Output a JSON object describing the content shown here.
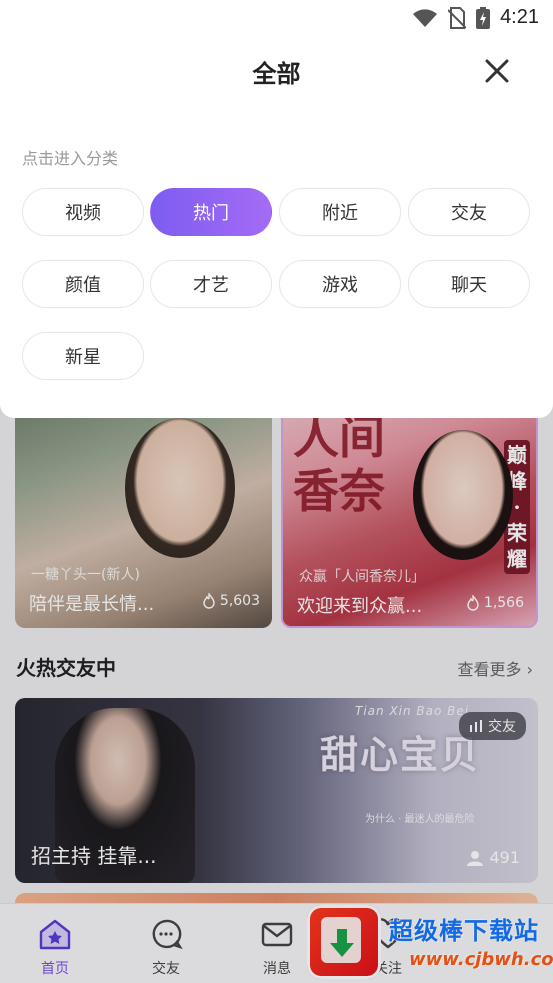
{
  "status_bar": {
    "time": "4:21"
  },
  "sheet": {
    "title": "全部",
    "hint": "点击进入分类",
    "categories": [
      {
        "label": "视频",
        "selected": false
      },
      {
        "label": "热门",
        "selected": true
      },
      {
        "label": "附近",
        "selected": false
      },
      {
        "label": "交友",
        "selected": false
      },
      {
        "label": "颜值",
        "selected": false
      },
      {
        "label": "才艺",
        "selected": false
      },
      {
        "label": "游戏",
        "selected": false
      },
      {
        "label": "聊天",
        "selected": false
      },
      {
        "label": "新星",
        "selected": false
      }
    ]
  },
  "feed": {
    "cards": [
      {
        "subtitle": "一糖丫头一(新人)",
        "title": "陪伴是最长情...",
        "count": "5,603"
      },
      {
        "subtitle": "众赢「人间香奈儿」",
        "title": "欢迎来到众赢...",
        "count": "1,566",
        "poster_text": "人间香奈",
        "side_text": "巅峰·荣耀"
      }
    ],
    "section": {
      "title": "火热交友中",
      "more": "查看更多"
    },
    "live": {
      "tag": "交友",
      "title": "招主持 挂靠...",
      "viewers": "491",
      "poster_title": "甜心宝贝",
      "poster_script": "Tian Xin Bao Bei",
      "poster_caption": "为什么 · 最迷人的最危险"
    }
  },
  "bottom_nav": [
    {
      "label": "首页",
      "icon": "home-icon",
      "active": true
    },
    {
      "label": "交友",
      "icon": "chat-bubble-icon",
      "active": false
    },
    {
      "label": "消息",
      "icon": "mail-icon",
      "active": false
    },
    {
      "label": "关注",
      "icon": "heart-icon",
      "active": false
    }
  ],
  "watermark": {
    "title": "超级棒下载站",
    "url": "www.cjbwh.com"
  },
  "colors": {
    "accent": "#7d5cf1",
    "accent_end": "#a46cf5",
    "hint": "#999999"
  }
}
